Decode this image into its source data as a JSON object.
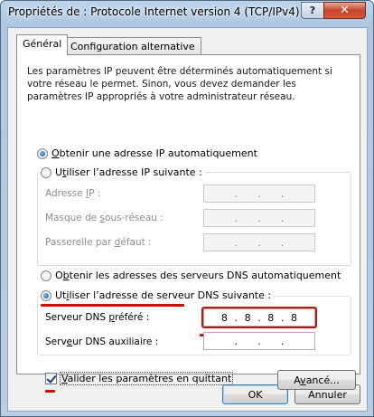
{
  "window": {
    "title": "Propriétés de : Protocole Internet version 4 (TCP/IPv4)",
    "help_label": "?",
    "close_label": "✕"
  },
  "tabs": [
    {
      "label": "Général",
      "active": true
    },
    {
      "label": "Configuration alternative",
      "active": false
    }
  ],
  "description": "Les paramètres IP peuvent être déterminés automatiquement si votre réseau le permet. Sinon, vous devez demander les paramètres IP appropriés à votre administrateur réseau.",
  "ip": {
    "auto_option": {
      "pre": "",
      "key": "O",
      "post": "btenir une adresse IP automatiquement",
      "checked": true
    },
    "manual_option": {
      "pre": "U",
      "key": "t",
      "post": "iliser l’adresse IP suivante :",
      "checked": false
    },
    "fields": [
      {
        "pre": "Adresse ",
        "key": "I",
        "post": "P :",
        "octets": [
          "",
          "",
          "",
          ""
        ]
      },
      {
        "pre": "Masque de ",
        "key": "s",
        "post": "ous-réseau :",
        "octets": [
          "",
          "",
          "",
          ""
        ]
      },
      {
        "pre": "Passerelle par ",
        "key": "d",
        "post": "éfaut :",
        "octets": [
          "",
          "",
          "",
          ""
        ]
      }
    ]
  },
  "dns": {
    "auto_option": {
      "pre": "O",
      "key": "b",
      "post": "tenir les adresses des serveurs DNS automatiquement",
      "checked": false
    },
    "manual_option": {
      "pre": "Ut",
      "key": "i",
      "post": "liser l’adresse de serveur DNS suivante :",
      "checked": true
    },
    "preferred": {
      "pre": "Serveur DNS ",
      "key": "p",
      "post": "référé :",
      "octets": [
        "8",
        "8",
        "8",
        "8"
      ]
    },
    "alternate": {
      "pre": "Serv",
      "key": "e",
      "post": "ur DNS auxiliaire :",
      "octets": [
        "",
        "",
        "",
        ""
      ]
    }
  },
  "validate": {
    "pre": "",
    "key": "V",
    "post": "alider les paramètres en quittant",
    "checked": true
  },
  "buttons": {
    "advanced": {
      "pre": "A",
      "key": "v",
      "post": "ancé..."
    },
    "ok": "OK",
    "cancel": "Annuler"
  },
  "colors": {
    "annotation_red": "#cc0b0b",
    "radio_blue": "#1f5ea8"
  }
}
